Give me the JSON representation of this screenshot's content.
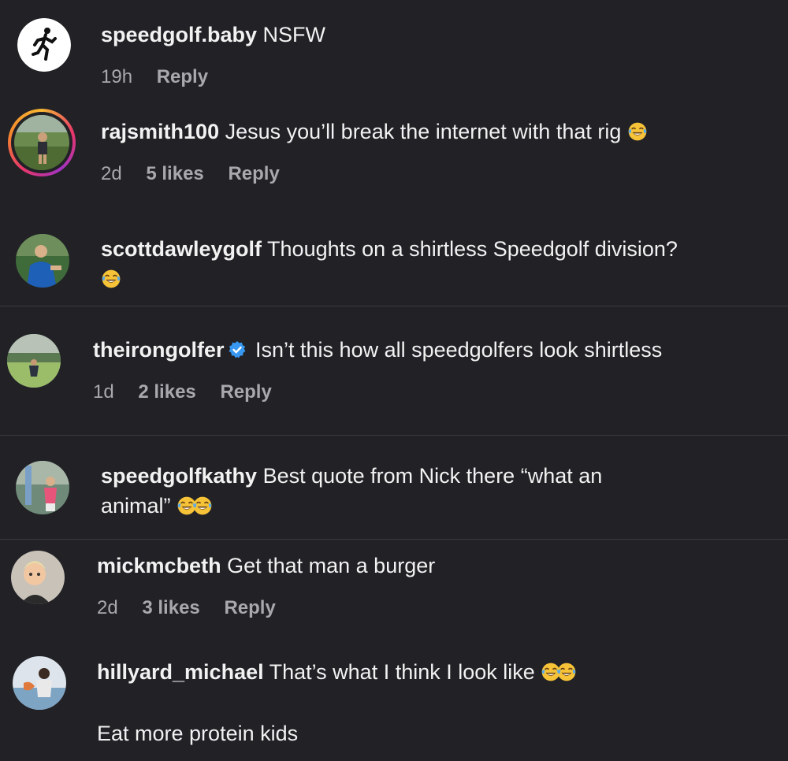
{
  "comments": [
    {
      "username": "speedgolf.baby",
      "text": "NSFW",
      "time": "19h",
      "likes": "",
      "reply": "Reply"
    },
    {
      "username": "rajsmith100",
      "text": "Jesus you’ll break the internet with that rig",
      "time": "2d",
      "likes": "5 likes",
      "reply": "Reply"
    },
    {
      "username": "scottdawleygolf",
      "text": "Thoughts on a shirtless Speedgolf division?",
      "time": "",
      "likes": "",
      "reply": ""
    },
    {
      "username": "theirongolfer",
      "text": "Isn’t this how all speedgolfers look shirtless",
      "time": "1d",
      "likes": "2 likes",
      "reply": "Reply"
    },
    {
      "username": "speedgolfkathy",
      "text": "Best quote from Nick there “what an",
      "text2": "animal”",
      "time": "",
      "likes": "",
      "reply": ""
    },
    {
      "username": "mickmcbeth",
      "text": "Get that man a burger",
      "time": "2d",
      "likes": "3 likes",
      "reply": "Reply"
    },
    {
      "username": "hillyard_michael",
      "text": "That’s what I think I look like",
      "text2": "Eat more protein kids",
      "time": "",
      "likes": "",
      "reply": ""
    }
  ],
  "colors": {
    "background": "#212126",
    "text": "#f2f2f2",
    "meta": "#a8a8ad",
    "verified": "#3897f0"
  },
  "icons": {
    "emoji": "face-with-tears-of-joy-icon",
    "verified": "verified-badge-icon",
    "runner": "runner-logo-icon"
  }
}
